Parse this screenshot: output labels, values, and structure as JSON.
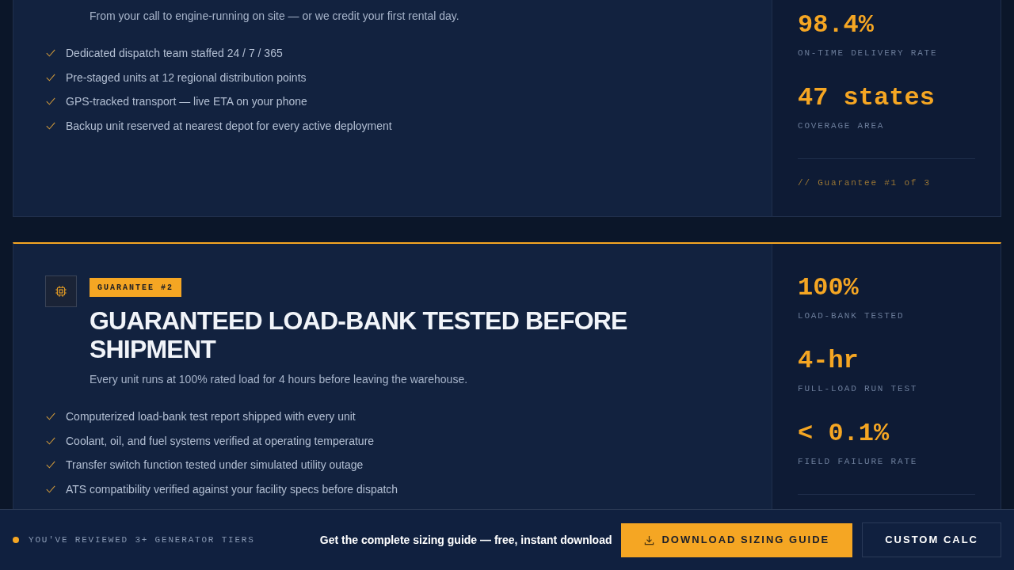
{
  "guarantees": [
    {
      "subtitle": "From your call to engine-running on site — or we credit your first rental day.",
      "features": [
        "Dedicated dispatch team staffed 24 / 7 / 365",
        "Pre-staged units at 12 regional distribution points",
        "GPS-tracked transport — live ETA on your phone",
        "Backup unit reserved at nearest depot for every active deployment"
      ],
      "stats": [
        {
          "value": "98.4%",
          "label": "ON-TIME DELIVERY RATE"
        },
        {
          "value": "47 states",
          "label": "COVERAGE AREA"
        }
      ],
      "footer": "// Guarantee #1 of 3"
    },
    {
      "badge": "GUARANTEE #2",
      "title": "GUARANTEED LOAD-BANK TESTED BEFORE SHIPMENT",
      "subtitle": "Every unit runs at 100% rated load for 4 hours before leaving the warehouse.",
      "features": [
        "Computerized load-bank test report shipped with every unit",
        "Coolant, oil, and fuel systems verified at operating temperature",
        "Transfer switch function tested under simulated utility outage",
        "ATS compatibility verified against your facility specs before dispatch"
      ],
      "stats": [
        {
          "value": "100%",
          "label": "LOAD-BANK TESTED"
        },
        {
          "value": "4-hr",
          "label": "FULL-LOAD RUN TEST"
        },
        {
          "value": "< 0.1%",
          "label": "FIELD FAILURE RATE"
        }
      ]
    }
  ],
  "sticky_bar": {
    "status": "YOU'VE REVIEWED 3+ GENERATOR TIERS",
    "prompt": "Get the complete sizing guide — free, instant download",
    "buttons": [
      {
        "label": "DOWNLOAD SIZING GUIDE",
        "kind": "primary"
      },
      {
        "label": "CUSTOM CALC",
        "kind": "secondary"
      }
    ]
  }
}
